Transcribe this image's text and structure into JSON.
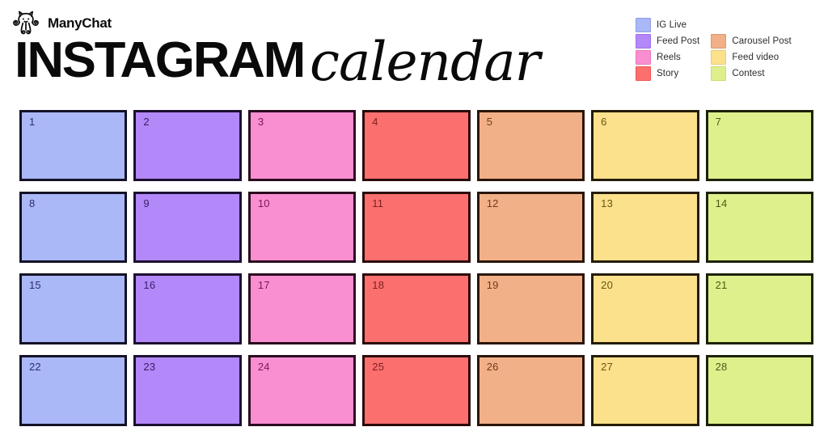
{
  "brand": {
    "name": "ManyChat",
    "logo_icon": "octopus-logo-icon"
  },
  "title": {
    "main": "INSTAGRAM",
    "script": "calendar"
  },
  "legend": {
    "items": [
      {
        "label": "IG Live",
        "color": "#aab8f7",
        "border": "#8f9fe8"
      },
      {
        "label": "Carousel Post",
        "color": "#f2b088",
        "border": "#e0996f"
      },
      {
        "label": "Feed Post",
        "color": "#b388f9",
        "border": "#9f71ec"
      },
      {
        "label": "Feed video",
        "color": "#fbe18b",
        "border": "#eccd6e"
      },
      {
        "label": "Reels",
        "color": "#f98fd1",
        "border": "#ec74bd"
      },
      {
        "label": "Contest",
        "color": "#def08c",
        "border": "#c9de6f"
      },
      {
        "label": "Story",
        "color": "#fb6f6f",
        "border": "#ee5555"
      }
    ]
  },
  "calendar": {
    "columns": [
      {
        "category": "IG Live",
        "fill": "#aab8f7",
        "border": "#141226",
        "number_color": "#2b2f6b"
      },
      {
        "category": "Feed Post",
        "fill": "#b388f9",
        "border": "#1c1030",
        "number_color": "#3c1d66"
      },
      {
        "category": "Reels",
        "fill": "#f98fd1",
        "border": "#2a0c1e",
        "number_color": "#7a1a52"
      },
      {
        "category": "Story",
        "fill": "#fb6f6f",
        "border": "#2b0a0a",
        "number_color": "#7d1f1f"
      },
      {
        "category": "Carousel Post",
        "fill": "#f2b088",
        "border": "#2a1509",
        "number_color": "#6e3c18"
      },
      {
        "category": "Feed video",
        "fill": "#fbe18b",
        "border": "#241c06",
        "number_color": "#6b5410"
      },
      {
        "category": "Contest",
        "fill": "#def08c",
        "border": "#1c2207",
        "number_color": "#4c5a16"
      }
    ],
    "days": [
      "1",
      "2",
      "3",
      "4",
      "5",
      "6",
      "7",
      "8",
      "9",
      "10",
      "11",
      "12",
      "13",
      "14",
      "15",
      "16",
      "17",
      "18",
      "19",
      "20",
      "21",
      "22",
      "23",
      "24",
      "25",
      "26",
      "27",
      "28"
    ]
  },
  "page": {
    "background": "#ffffff"
  }
}
